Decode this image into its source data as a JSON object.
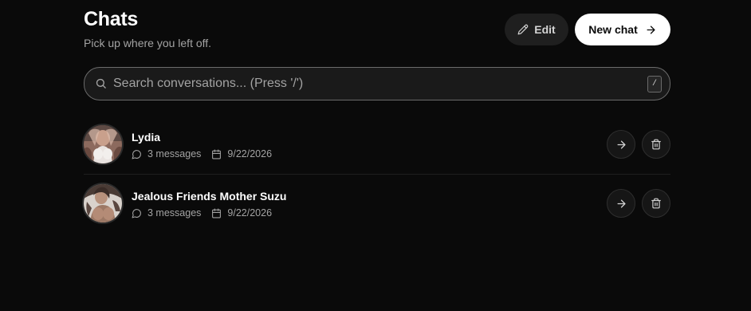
{
  "header": {
    "title": "Chats",
    "subtitle": "Pick up where you left off.",
    "edit_label": "Edit",
    "new_chat_label": "New chat"
  },
  "search": {
    "placeholder": "Search conversations... (Press '/')",
    "shortcut": "/",
    "icon": "search-icon"
  },
  "chats": [
    {
      "name": "Lydia",
      "messages": "3 messages",
      "date": "9/22/2026"
    },
    {
      "name": "Jealous Friends Mother Suzu",
      "messages": "3 messages",
      "date": "9/22/2026"
    }
  ],
  "colors": {
    "background": "#0a0a0a",
    "accent": "#ffffff",
    "muted_text": "#a3a3a3"
  }
}
